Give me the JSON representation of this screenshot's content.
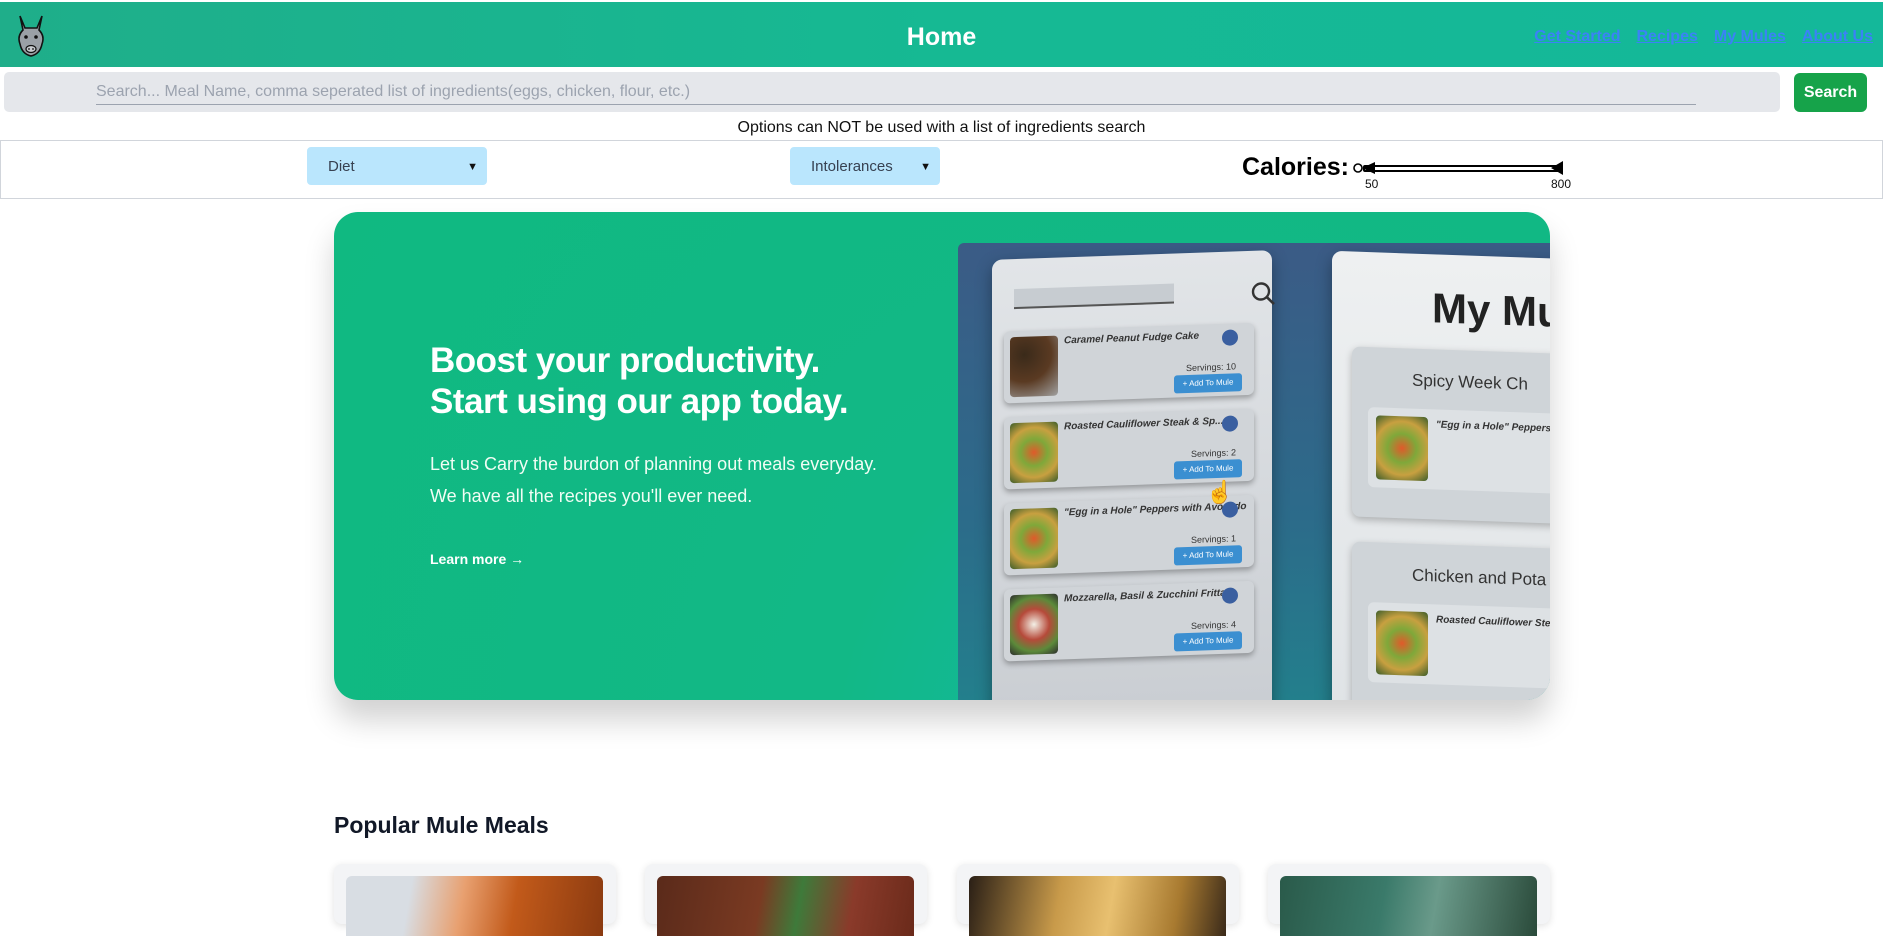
{
  "header": {
    "title": "Home",
    "nav": [
      "Get Started",
      "Recipes",
      "My Mules",
      "About Us"
    ]
  },
  "search": {
    "placeholder": "Search... Meal Name, comma seperated list of ingredients(eggs, chicken, flour, etc.)",
    "button_label": "Search",
    "note": "Options can NOT be used with a list of ingredients search"
  },
  "filters": {
    "diet_selected": "Diet",
    "intolerances_selected": "Intolerances",
    "calories_label": "Calories:",
    "calories_min": "50",
    "calories_max": "800"
  },
  "hero": {
    "title_line1": "Boost your productivity.",
    "title_line2": "Start using our app today.",
    "subtitle_line1": "Let us Carry the burdon of planning out meals everyday.",
    "subtitle_line2": "We have all the recipes you'll ever need.",
    "link": "Learn more →",
    "mockup": {
      "heading": "My Mul",
      "cards": [
        {
          "name": "Caramel Peanut Fudge Cake",
          "servings": "Servings: 10",
          "button": "+ Add To Mule"
        },
        {
          "name": "Roasted Cauliflower Steak & Sp...",
          "servings": "Servings: 2",
          "button": "+ Add To Mule"
        },
        {
          "name": "\"Egg in a Hole\" Peppers with Avocado",
          "servings": "Servings: 1",
          "button": "+ Add To Mule"
        },
        {
          "name": "Mozzarella, Basil & Zucchini Frittata",
          "servings": "Servings: 4",
          "button": "+ Add To Mule"
        }
      ],
      "sections": [
        {
          "title": "Spicy Week Ch",
          "item": "\"Egg in a Hole\" Peppers w"
        },
        {
          "title": "Chicken and Pota",
          "item": "Roasted Cauliflower Steak"
        }
      ]
    }
  },
  "popular": {
    "title": "Popular Mule Meals"
  },
  "colors": {
    "header": "#16b993",
    "hero": "#10b981",
    "search_button": "#16a34a",
    "select": "#bae6fd",
    "nav_link": "#3b82f6"
  }
}
